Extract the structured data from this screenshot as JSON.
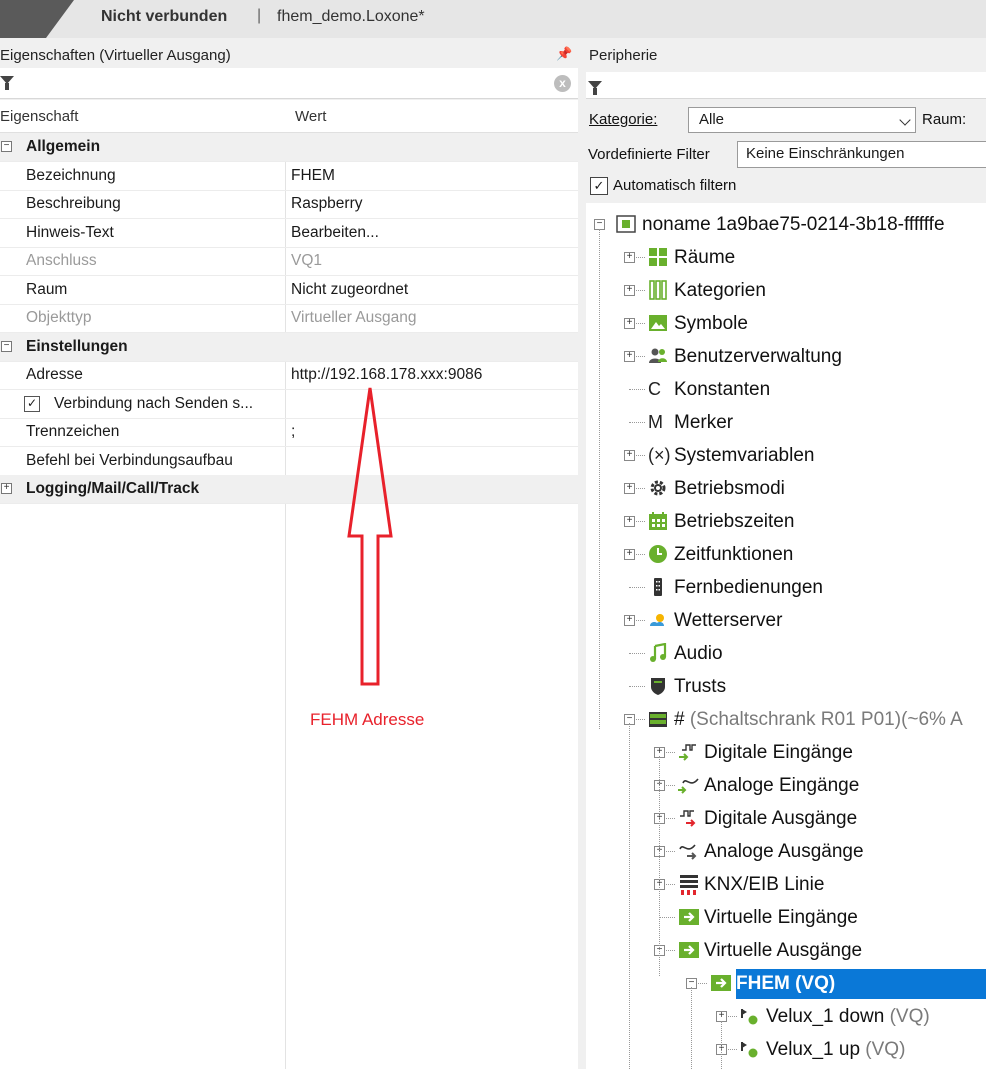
{
  "topbar": {
    "status": "Nicht verbunden",
    "separator": "|",
    "project": "fhem_demo.Loxone*"
  },
  "left": {
    "title": "Eigenschaften (Virtueller Ausgang)",
    "pin": "↓",
    "clear": "x",
    "columns": {
      "property": "Eigenschaft",
      "value": "Wert"
    },
    "rows": [
      {
        "type": "cat",
        "expander": "−",
        "key": "Allgemein"
      },
      {
        "key": "Bezeichnung",
        "value": "FHEM"
      },
      {
        "key": "Beschreibung",
        "value": "Raspberry"
      },
      {
        "key": "Hinweis-Text",
        "value": "Bearbeiten..."
      },
      {
        "key": "Anschluss",
        "value": "VQ1",
        "dim": true
      },
      {
        "key": "Raum",
        "value": "Nicht zugeordnet"
      },
      {
        "key": "Objekttyp",
        "value": "Virtueller Ausgang",
        "dim": true
      },
      {
        "type": "cat",
        "expander": "−",
        "key": "Einstellungen"
      },
      {
        "key": "Adresse",
        "value": "http://192.168.178.xxx:9086"
      },
      {
        "type": "check",
        "key": "Verbindung nach Senden s...",
        "checked": "✓"
      },
      {
        "key": "Trennzeichen",
        "value": ";"
      },
      {
        "key": "Befehl bei Verbindungsaufbau",
        "value": ""
      },
      {
        "type": "cat",
        "expander": "+",
        "key": "Logging/Mail/Call/Track"
      }
    ]
  },
  "annotation": {
    "text": "FEHM Adresse",
    "color": "#e8212b"
  },
  "right": {
    "title": "Peripherie",
    "kategorie_label": "Kategorie:",
    "kategorie_value": "Alle",
    "raum_label": "Raum:",
    "filter_label": "Vordefinierte Filter",
    "filter_value": "Keine Einschränkungen",
    "auto_label": "Automatisch filtern",
    "auto_checked": "✓",
    "tree": [
      {
        "level": 0,
        "exp": "−",
        "icon": "miniserver-icon",
        "label": "noname 1a9bae75-0214-3b18-ffffffe"
      },
      {
        "level": 1,
        "exp": "+",
        "icon": "rooms-icon",
        "label": "Räume"
      },
      {
        "level": 1,
        "exp": "+",
        "icon": "categories-icon",
        "label": "Kategorien"
      },
      {
        "level": 1,
        "exp": "+",
        "icon": "symbols-icon",
        "label": "Symbole"
      },
      {
        "level": 1,
        "exp": "+",
        "icon": "users-icon",
        "label": "Benutzerverwaltung"
      },
      {
        "level": 1,
        "exp": "",
        "icon": "constants-icon",
        "glyph": "C",
        "label": "Konstanten"
      },
      {
        "level": 1,
        "exp": "",
        "icon": "flags-icon",
        "glyph": "M",
        "label": "Merker"
      },
      {
        "level": 1,
        "exp": "+",
        "icon": "variables-icon",
        "glyph": "(×)",
        "label": "Systemvariablen"
      },
      {
        "level": 1,
        "exp": "+",
        "icon": "gear-icon",
        "label": "Betriebsmodi"
      },
      {
        "level": 1,
        "exp": "+",
        "icon": "calendar-icon",
        "label": "Betriebszeiten"
      },
      {
        "level": 1,
        "exp": "+",
        "icon": "clock-icon",
        "label": "Zeitfunktionen"
      },
      {
        "level": 1,
        "exp": "",
        "icon": "remote-icon",
        "label": "Fernbedienungen"
      },
      {
        "level": 1,
        "exp": "+",
        "icon": "weather-icon",
        "label": "Wetterserver"
      },
      {
        "level": 1,
        "exp": "",
        "icon": "music-icon",
        "label": "Audio"
      },
      {
        "level": 1,
        "exp": "",
        "icon": "shield-icon",
        "label": "Trusts"
      },
      {
        "level": 1,
        "exp": "−",
        "icon": "cabinet-icon",
        "label": "#",
        "sub": " (Schaltschrank R01 P01)(~6% A"
      },
      {
        "level": 2,
        "exp": "+",
        "icon": "digital-input-icon",
        "label": "Digitale Eingänge"
      },
      {
        "level": 2,
        "exp": "+",
        "icon": "analog-input-icon",
        "label": "Analoge Eingänge"
      },
      {
        "level": 2,
        "exp": "+",
        "icon": "digital-output-icon",
        "label": "Digitale Ausgänge"
      },
      {
        "level": 2,
        "exp": "+",
        "icon": "analog-output-icon",
        "label": "Analoge Ausgänge"
      },
      {
        "level": 2,
        "exp": "+",
        "icon": "knx-icon",
        "label": "KNX/EIB Linie"
      },
      {
        "level": 2,
        "exp": "",
        "icon": "virtual-input-icon",
        "label": "Virtuelle Eingänge"
      },
      {
        "level": 2,
        "exp": "−",
        "icon": "virtual-output-icon",
        "label": "Virtuelle Ausgänge"
      },
      {
        "level": 3,
        "exp": "−",
        "icon": "virtual-output-icon",
        "label": "FHEM (VQ)",
        "selected": true
      },
      {
        "level": 4,
        "exp": "+",
        "icon": "output-command-icon",
        "label": "Velux_1 down",
        "sub": " (VQ)"
      },
      {
        "level": 4,
        "exp": "+",
        "icon": "output-command-icon",
        "label": "Velux_1 up",
        "sub": " (VQ)"
      }
    ]
  },
  "colors": {
    "selection": "#0a78d7",
    "green": "#69b02d",
    "annotation": "#e8212b"
  }
}
